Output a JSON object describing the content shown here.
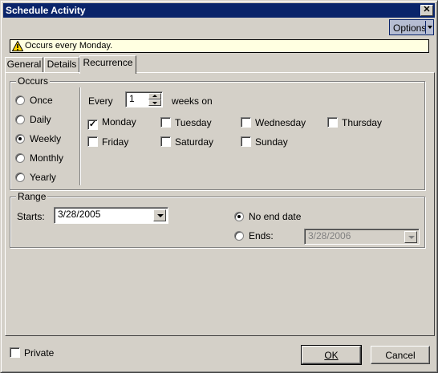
{
  "window": {
    "title": "Schedule Activity",
    "close_glyph": "✕"
  },
  "toolbar": {
    "options_label": "Options"
  },
  "banner": {
    "icon": "warning-icon",
    "text": "Occurs every Monday."
  },
  "tabs": [
    {
      "label": "General",
      "active": false
    },
    {
      "label": "Details",
      "active": false
    },
    {
      "label": "Recurrence",
      "active": true
    }
  ],
  "occurs": {
    "legend": "Occurs",
    "options": [
      {
        "label": "Once",
        "selected": false
      },
      {
        "label": "Daily",
        "selected": false
      },
      {
        "label": "Weekly",
        "selected": true
      },
      {
        "label": "Monthly",
        "selected": false
      },
      {
        "label": "Yearly",
        "selected": false
      }
    ],
    "every_label": "Every",
    "every_value": "1",
    "weeks_on_label": "weeks on",
    "days": [
      {
        "label": "Monday",
        "checked": true
      },
      {
        "label": "Tuesday",
        "checked": false
      },
      {
        "label": "Wednesday",
        "checked": false
      },
      {
        "label": "Thursday",
        "checked": false
      },
      {
        "label": "Friday",
        "checked": false
      },
      {
        "label": "Saturday",
        "checked": false
      },
      {
        "label": "Sunday",
        "checked": false
      }
    ]
  },
  "range": {
    "legend": "Range",
    "starts_label": "Starts:",
    "starts_value": "3/28/2005",
    "no_end_label": "No end date",
    "no_end_selected": true,
    "ends_label": "Ends:",
    "ends_selected": false,
    "ends_value": "3/28/2006"
  },
  "footer": {
    "private_label": "Private",
    "private_checked": false,
    "ok_label": "OK",
    "cancel_label": "Cancel"
  }
}
